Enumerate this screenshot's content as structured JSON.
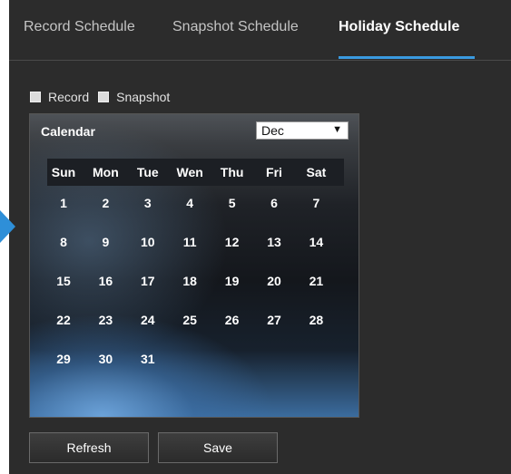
{
  "tabs": [
    {
      "label": "Record Schedule"
    },
    {
      "label": "Snapshot Schedule"
    },
    {
      "label": "Holiday Schedule"
    }
  ],
  "active_tab": 2,
  "options": {
    "record_label": "Record",
    "snapshot_label": "Snapshot"
  },
  "calendar": {
    "title": "Calendar",
    "month": "Dec",
    "weekdays": [
      "Sun",
      "Mon",
      "Tue",
      "Wen",
      "Thu",
      "Fri",
      "Sat"
    ],
    "weeks": [
      [
        "1",
        "2",
        "3",
        "4",
        "5",
        "6",
        "7"
      ],
      [
        "8",
        "9",
        "10",
        "11",
        "12",
        "13",
        "14"
      ],
      [
        "15",
        "16",
        "17",
        "18",
        "19",
        "20",
        "21"
      ],
      [
        "22",
        "23",
        "24",
        "25",
        "26",
        "27",
        "28"
      ],
      [
        "29",
        "30",
        "31"
      ]
    ]
  },
  "buttons": {
    "refresh_label": "Refresh",
    "save_label": "Save"
  },
  "colors": {
    "accent": "#3a9ae0",
    "panel_bg": "#2c2c2c"
  },
  "icons": {
    "side_marker": "triangle-right-icon",
    "dropdown": "triangle-down-icon"
  }
}
